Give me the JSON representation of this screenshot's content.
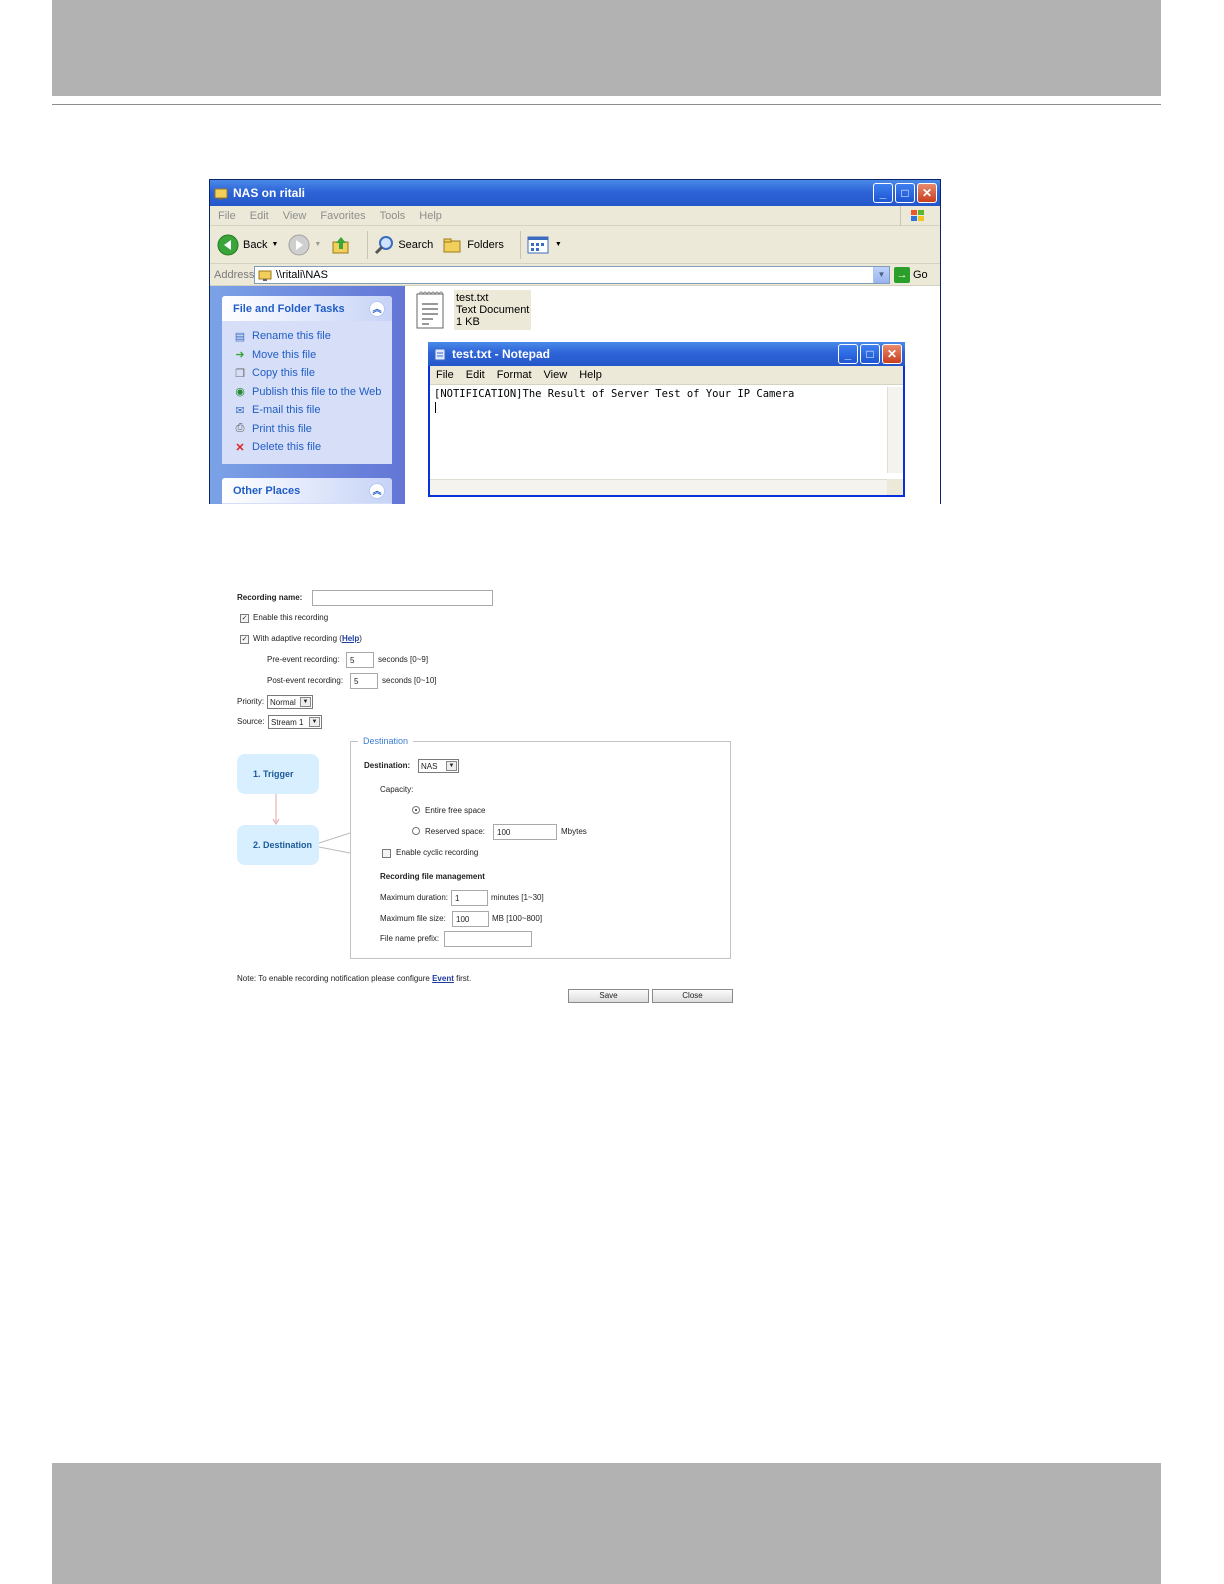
{
  "explorer": {
    "title": "NAS on ritali",
    "menu": [
      "File",
      "Edit",
      "View",
      "Favorites",
      "Tools",
      "Help"
    ],
    "toolbar": {
      "back": "Back",
      "search": "Search",
      "folders": "Folders"
    },
    "address_label": "Address",
    "address_value": "\\\\ritali\\NAS",
    "go": "Go",
    "file_tasks": {
      "title": "File and Folder Tasks",
      "items": [
        "Rename this file",
        "Move this file",
        "Copy this file",
        "Publish this file to the Web",
        "E-mail this file",
        "Print this file",
        "Delete this file"
      ]
    },
    "other_places": "Other Places",
    "file": {
      "name": "test.txt",
      "type": "Text Document",
      "size": "1 KB"
    }
  },
  "notepad": {
    "title": "test.txt - Notepad",
    "menu": [
      "File",
      "Edit",
      "Format",
      "View",
      "Help"
    ],
    "content": "[NOTIFICATION]The Result of Server Test of Your IP Camera"
  },
  "recording": {
    "name_label": "Recording name:",
    "name_value": "",
    "enable_label": "Enable this recording",
    "enable_checked": true,
    "adaptive_label": "With adaptive recording (",
    "adaptive_help": "Help",
    "adaptive_close": ")",
    "adaptive_checked": true,
    "pre_label": "Pre-event recording:",
    "pre_value": "5",
    "pre_unit": "seconds [0~9]",
    "post_label": "Post-event recording:",
    "post_value": "5",
    "post_unit": "seconds [0~10]",
    "priority_label": "Priority:",
    "priority_value": "Normal",
    "source_label": "Source:",
    "source_value": "Stream 1",
    "steps": [
      "1.  Trigger",
      "2.  Destination"
    ],
    "destination": {
      "legend": "Destination",
      "label": "Destination:",
      "value": "NAS",
      "capacity_label": "Capacity:",
      "entire_label": "Entire free space",
      "entire_selected": true,
      "reserved_label": "Reserved space:",
      "reserved_value": "100",
      "reserved_unit": "Mbytes",
      "cyclic_label": "Enable cyclic recording",
      "cyclic_checked": false,
      "mgmt_title": "Recording file management",
      "max_duration_label": "Maximum duration:",
      "max_duration_value": "1",
      "max_duration_unit": "minutes [1~30]",
      "max_size_label": "Maximum file size:",
      "max_size_value": "100",
      "max_size_unit": "MB [100~800]",
      "prefix_label": "File name prefix:",
      "prefix_value": ""
    },
    "note_prefix": "Note: To enable recording notification please configure ",
    "note_link": "Event",
    "note_suffix": " first.",
    "save": "Save",
    "close": "Close"
  }
}
